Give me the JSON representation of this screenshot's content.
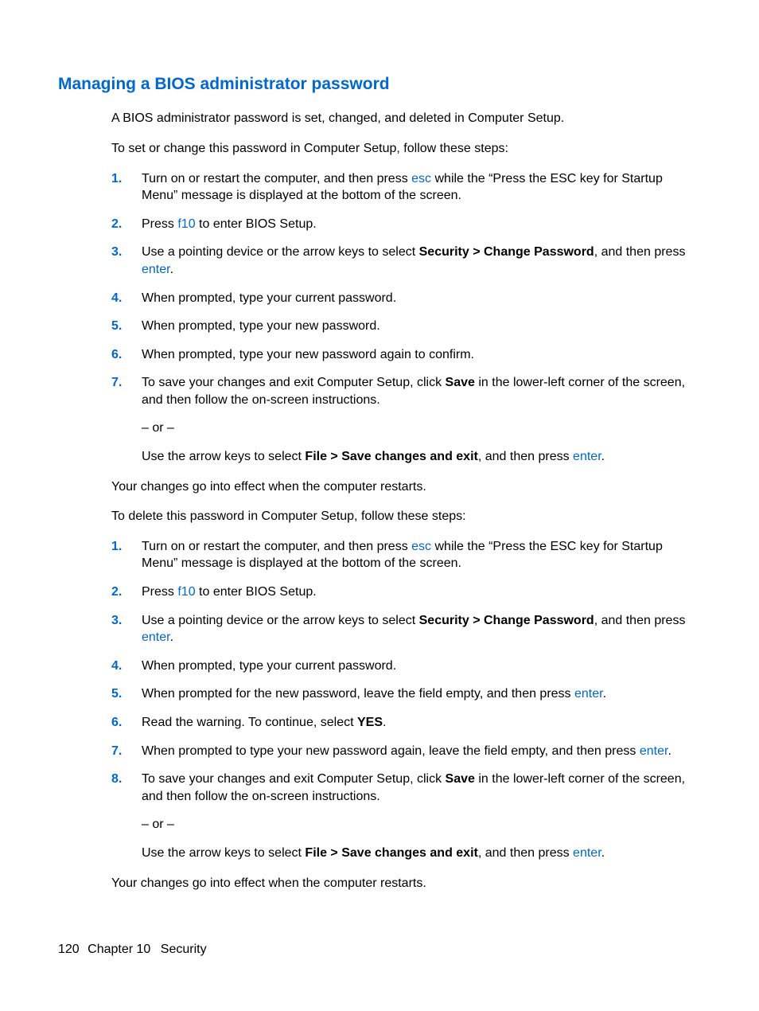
{
  "colors": {
    "link": "#0068cf"
  },
  "heading": "Managing a BIOS administrator password",
  "intro1": "A BIOS administrator password is set, changed, and deleted in Computer Setup.",
  "intro2": "To set or change this password in Computer Setup, follow these steps:",
  "keys": {
    "esc": "esc",
    "f10": "f10",
    "enter": "enter"
  },
  "setSteps": {
    "s1a": "Turn on or restart the computer, and then press ",
    "s1b": " while the “Press the ESC key for Startup Menu” message is displayed at the bottom of the screen.",
    "s2a": "Press ",
    "s2b": " to enter BIOS Setup.",
    "s3a": "Use a pointing device or the arrow keys to select ",
    "s3bold": "Security > Change Password",
    "s3b": ", and then press ",
    "s3c": ".",
    "s4": "When prompted, type your current password.",
    "s5": "When prompted, type your new password.",
    "s6": "When prompted, type your new password again to confirm.",
    "s7a": "To save your changes and exit Computer Setup, click ",
    "s7bold": "Save",
    "s7b": " in the lower-left corner of the screen, and then follow the on-screen instructions.",
    "or": "– or –",
    "s7c": "Use the arrow keys to select ",
    "s7cbold": "File > Save changes and exit",
    "s7d": ", and then press ",
    "s7e": "."
  },
  "after1": "Your changes go into effect when the computer restarts.",
  "intro3": "To delete this password in Computer Setup, follow these steps:",
  "delSteps": {
    "s1a": "Turn on or restart the computer, and then press ",
    "s1b": " while the “Press the ESC key for Startup Menu” message is displayed at the bottom of the screen.",
    "s2a": "Press ",
    "s2b": " to enter BIOS Setup.",
    "s3a": "Use a pointing device or the arrow keys to select ",
    "s3bold": "Security > Change Password",
    "s3b": ", and then press ",
    "s3c": ".",
    "s4": "When prompted, type your current password.",
    "s5a": "When prompted for the new password, leave the field empty, and then press ",
    "s5b": ".",
    "s6a": "Read the warning. To continue, select ",
    "s6bold": "YES",
    "s6b": ".",
    "s7a": "When prompted to type your new password again, leave the field empty, and then press ",
    "s7b": ".",
    "s8a": "To save your changes and exit Computer Setup, click ",
    "s8bold": "Save",
    "s8b": " in the lower-left corner of the screen, and then follow the on-screen instructions.",
    "or": "– or –",
    "s8c": "Use the arrow keys to select ",
    "s8cbold": "File > Save changes and exit",
    "s8d": ", and then press ",
    "s8e": "."
  },
  "after2": "Your changes go into effect when the computer restarts.",
  "nums": {
    "n1": "1.",
    "n2": "2.",
    "n3": "3.",
    "n4": "4.",
    "n5": "5.",
    "n6": "6.",
    "n7": "7.",
    "n8": "8."
  },
  "footer": {
    "page": "120",
    "chapter": "Chapter 10",
    "title": "Security"
  }
}
